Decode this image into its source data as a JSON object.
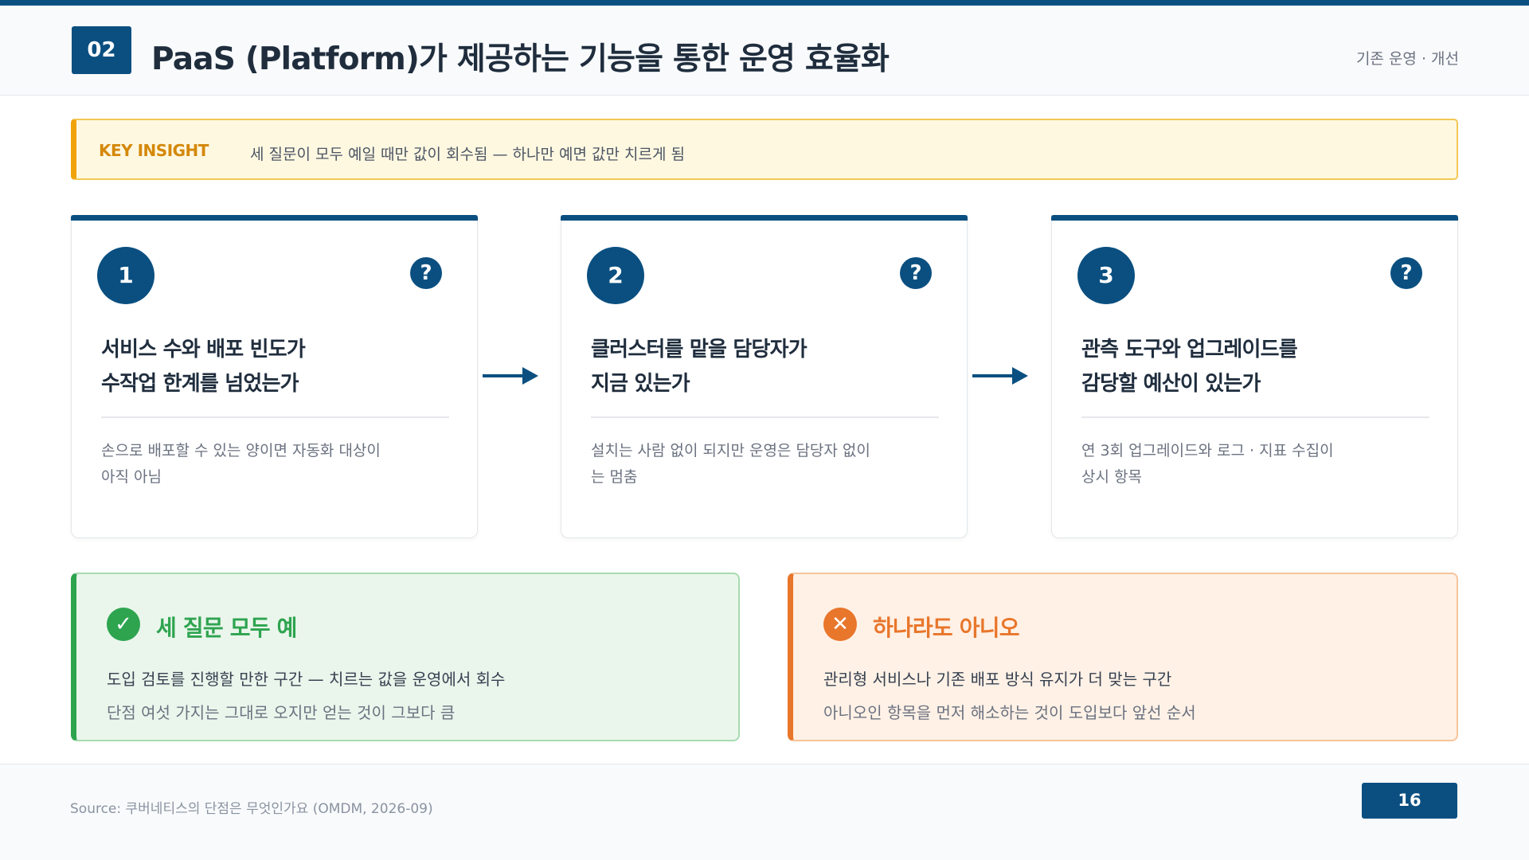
{
  "header": {
    "section_number": "02",
    "title": "PaaS (Platform)가 제공하는 기능을 통한 운영 효율화",
    "tag": "기존 운영 · 개선"
  },
  "insight": {
    "label": "KEY INSIGHT",
    "text": "세 질문이 모두 예일 때만 값이 회수됨 — 하나만 예면 값만 치르게 됨"
  },
  "steps": [
    {
      "number": "1",
      "icon": "question-icon",
      "title_line1": "서비스 수와 배포 빈도가",
      "title_line2": "수작업 한계를 넘었는가",
      "desc_line1": "손으로 배포할 수 있는 양이면 자동화 대상이",
      "desc_line2": "아직 아님"
    },
    {
      "number": "2",
      "icon": "question-icon",
      "title_line1": "클러스터를 맡을 담당자가",
      "title_line2": "지금 있는가",
      "desc_line1": "설치는 사람 없이 되지만 운영은 담당자 없이",
      "desc_line2": "는 멈춤"
    },
    {
      "number": "3",
      "icon": "question-icon",
      "title_line1": "관측 도구와 업그레이드를",
      "title_line2": "감당할 예산이 있는가",
      "desc_line1": "연 3회 업그레이드와 로그 · 지표 수집이",
      "desc_line2": "상시 항목"
    }
  ],
  "results": {
    "yes": {
      "icon": "check-icon",
      "title": "세 질문 모두 예",
      "line1": "도입 검토를 진행할 만한 구간 — 치르는 값을 운영에서 회수",
      "line2": "단점 여섯 가지는 그대로 오지만 얻는 것이 그보다 큼"
    },
    "no": {
      "icon": "x-icon",
      "title": "하나라도 아니오",
      "line1": "관리형 서비스나 기존 배포 방식 유지가 더 맞는 구간",
      "line2": "아니오인 항목을 먼저 해소하는 것이 도입보다 앞선 순서"
    }
  },
  "footer": {
    "source": "Source: 쿠버네티스의 단점은 무엇인가요 (OMDM, 2026-09)",
    "page_number": "16"
  },
  "colors": {
    "primary": "#0a4f80",
    "insight_accent": "#f0a30a",
    "yes_accent": "#2ea44f",
    "no_accent": "#e8762b"
  }
}
